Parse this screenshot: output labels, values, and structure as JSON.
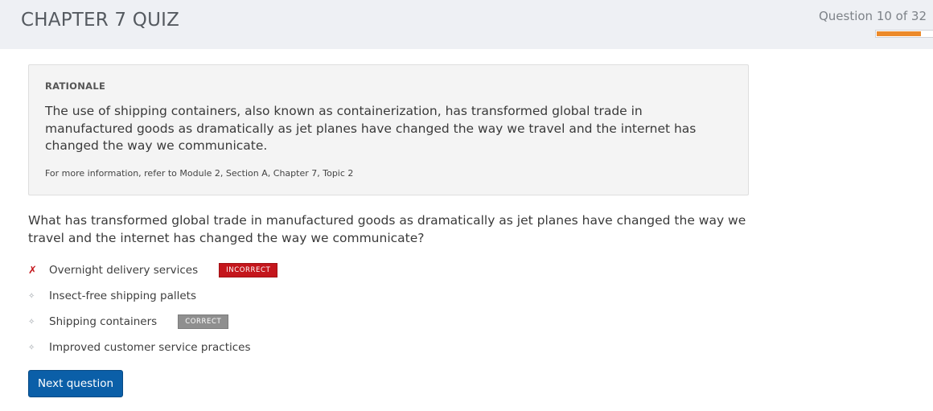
{
  "header": {
    "title": "CHAPTER 7 QUIZ",
    "progress_text": "Question 10 of 32",
    "progress_fraction": 0.3125,
    "progress_color": "#ec8a2a",
    "background": "#eef0f4"
  },
  "rationale": {
    "heading": "RATIONALE",
    "body": "The use of shipping containers, also known as containerization, has transformed global trade in manufactured goods as dramatically as jet planes have changed the way we travel and the internet has changed the way we communicate.",
    "reference": "For more information, refer to Module 2, Section A, Chapter 7, Topic 2"
  },
  "question": {
    "text": "What has transformed global trade in manufactured goods as dramatically as jet planes have changed the way we travel and the internet has changed the way we communicate?"
  },
  "answers": [
    {
      "label": "Overnight delivery services",
      "state": "selected-incorrect",
      "badge": "INCORRECT",
      "mark_icon": "cross-icon"
    },
    {
      "label": "Insect-free shipping pallets",
      "state": "unselected",
      "badge": "",
      "mark_icon": "diamond-bullet-icon"
    },
    {
      "label": "Shipping containers",
      "state": "correct",
      "badge": "CORRECT",
      "mark_icon": "diamond-bullet-icon"
    },
    {
      "label": "Improved customer service practices",
      "state": "unselected",
      "badge": "",
      "mark_icon": "diamond-bullet-icon"
    }
  ],
  "colors": {
    "incorrect": "#c4161c",
    "correct_badge": "#8f8f8f",
    "primary_button": "#0b5fa8"
  },
  "actions": {
    "next_label": "Next question"
  }
}
